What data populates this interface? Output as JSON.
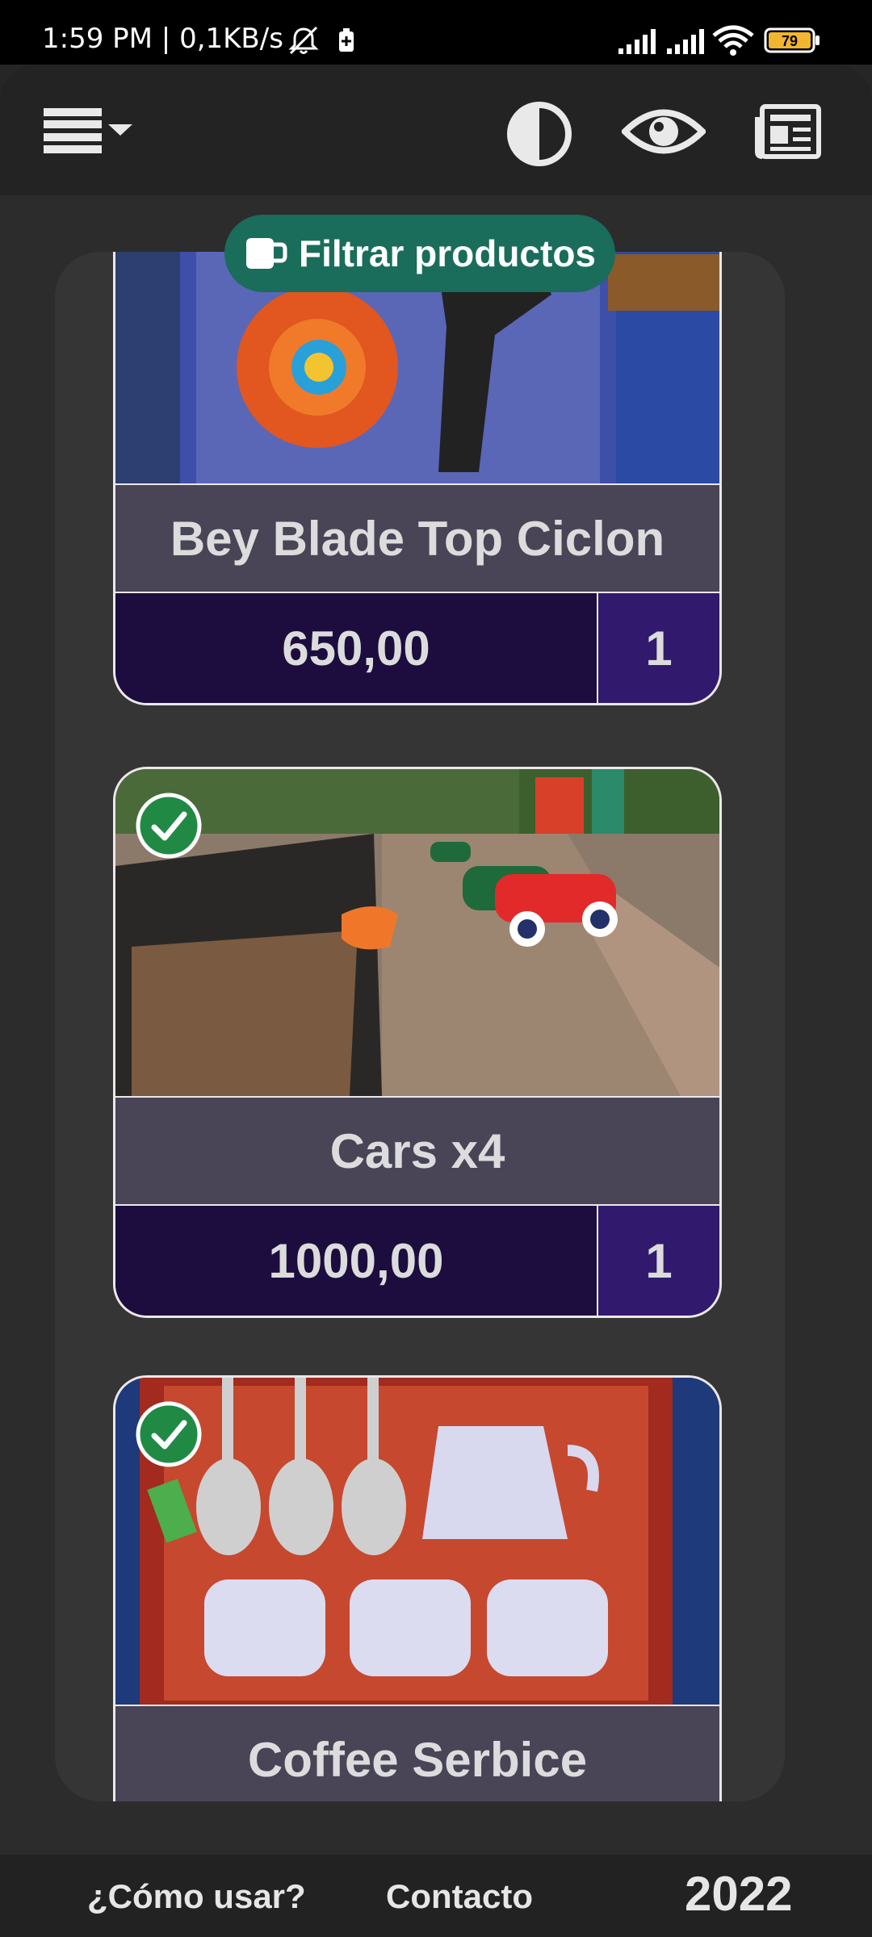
{
  "status_bar": {
    "time_speed": "1:59 PM | 0,1KB/s",
    "battery_level": "79",
    "icons": [
      "bell-muted-icon",
      "battery-saver-icon",
      "signal-icon",
      "signal-icon",
      "wifi-icon",
      "battery-icon"
    ]
  },
  "header": {
    "icons": [
      "menu-dropdown-icon",
      "contrast-icon",
      "eye-icon",
      "newspaper-icon"
    ]
  },
  "filter_button": {
    "label": "Filtrar productos",
    "icon": "mug-icon",
    "color": "#1a6d5a"
  },
  "products": [
    {
      "name": "Bey Blade Top Ciclon",
      "price": "650,00",
      "qty": "1",
      "checked": false
    },
    {
      "name": "Cars x4",
      "price": "1000,00",
      "qty": "1",
      "checked": true
    },
    {
      "name": "Coffee Serbice",
      "checked": true
    }
  ],
  "footer": {
    "help_link": "¿Cómo usar?",
    "contact_link": "Contacto",
    "year": "2022"
  },
  "colors": {
    "price_bg": "#1c0d3e",
    "qty_bg": "#311a6e",
    "title_bg": "#494456",
    "card_border": "#ece7ea"
  }
}
